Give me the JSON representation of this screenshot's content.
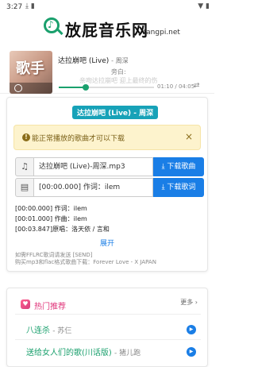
{
  "status": {
    "time": "3:27",
    "left_icons": "⤓ ▮",
    "right_icons": "▼ ▮"
  },
  "header": {
    "brand": "放屁音乐网",
    "domain": "fangpi.net"
  },
  "player": {
    "cover_text": "歌手",
    "title": "达拉崩吧 (Live)",
    "artist": "- 周深",
    "lyric_current": "旁白:",
    "lyric_next": "亲吻达拉崩吧 迎上最终的伤",
    "progress": 0.28,
    "time": "01:10 / 04:05",
    "loop_icon": "⇄"
  },
  "song": {
    "badge": "达拉崩吧 (Live) - 周深",
    "alert": "能正常播放的歌曲才可以下载",
    "alert_close": "×",
    "file_name": "达拉崩吧 (Live)-周深.mp3",
    "download_song": "⤓ 下载歌曲",
    "lrc_preview": "[00:00.000] 作词：ilem",
    "download_lrc": "⤓ 下载歌词",
    "music_icon": "♫",
    "doc_icon": "▤",
    "lyrics": [
      "[00:00.000] 作词：ilem",
      "[00:01.000] 作曲：ilem",
      "[00:03.847]原唱：洛天依 / 言和"
    ],
    "expand": "展开",
    "cut_line1": "如需FFLRC歌词请发送 [SEND]",
    "cut_line2": "购买mp3和flac格式歌曲下载：Forever Love - X JAPAN"
  },
  "hot": {
    "title": "热门推荐",
    "more": "更多 ›",
    "heart": "♥",
    "items": [
      {
        "title": "八连杀",
        "artist": "- 苏仨"
      },
      {
        "title": "送给女人们的歌(川话版)",
        "artist": "- 猪儿跑"
      }
    ]
  }
}
